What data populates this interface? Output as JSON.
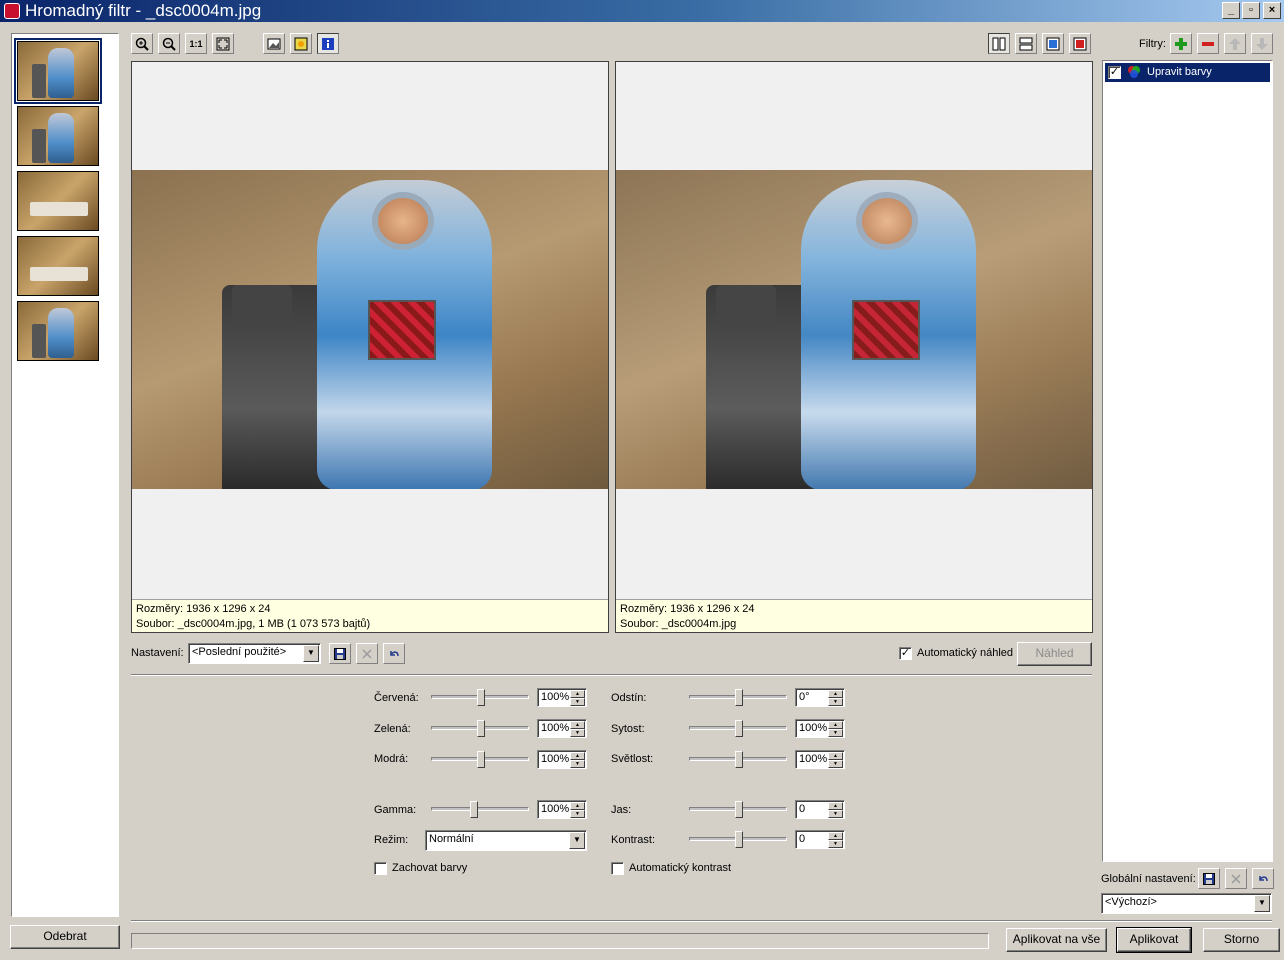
{
  "window": {
    "title": "Hromadný filtr - _dsc0004m.jpg",
    "controls": {
      "minimize": "_",
      "restore": "▫",
      "close": "×"
    }
  },
  "left_panel": {
    "thumbnail_count": 5,
    "remove_button": "Odebrat"
  },
  "toolbar": {
    "zoom_1to1": "1:1",
    "filters_label": "Filtry:"
  },
  "preview_left": {
    "dimensions": "Rozměry: 1936 x 1296 x 24",
    "file": "Soubor: _dsc0004m.jpg, 1 MB (1 073 573 bajtů)"
  },
  "preview_right": {
    "dimensions": "Rozměry: 1936 x 1296 x 24",
    "file": "Soubor: _dsc0004m.jpg"
  },
  "settings": {
    "label": "Nastavení:",
    "value": "<Poslední použité>",
    "auto_preview_label": "Automatický náhled",
    "auto_preview_checked": true,
    "preview_button": "Náhled"
  },
  "adjustments": {
    "red": {
      "label": "Červená:",
      "value": "100%"
    },
    "green": {
      "label": "Zelená:",
      "value": "100%"
    },
    "blue": {
      "label": "Modrá:",
      "value": "100%"
    },
    "hue": {
      "label": "Odstín:",
      "value": "0°"
    },
    "saturation": {
      "label": "Sytost:",
      "value": "100%"
    },
    "lightness": {
      "label": "Světlost:",
      "value": "100%"
    },
    "gamma": {
      "label": "Gamma:",
      "value": "100%"
    },
    "brightness": {
      "label": "Jas:",
      "value": "0"
    },
    "contrast": {
      "label": "Kontrast:",
      "value": "0"
    },
    "mode": {
      "label": "Režim:",
      "value": "Normální"
    },
    "keep_colors": {
      "label": "Zachovat barvy",
      "checked": false
    },
    "auto_contrast": {
      "label": "Automatický kontrast",
      "checked": false
    }
  },
  "filters_panel": {
    "items": [
      {
        "label": "Upravit barvy",
        "checked": true,
        "selected": true
      }
    ],
    "global_label": "Globální nastavení:",
    "global_value": "<Výchozí>"
  },
  "bottom": {
    "apply_all": "Aplikovat na vše",
    "apply": "Aplikovat",
    "cancel": "Storno"
  }
}
